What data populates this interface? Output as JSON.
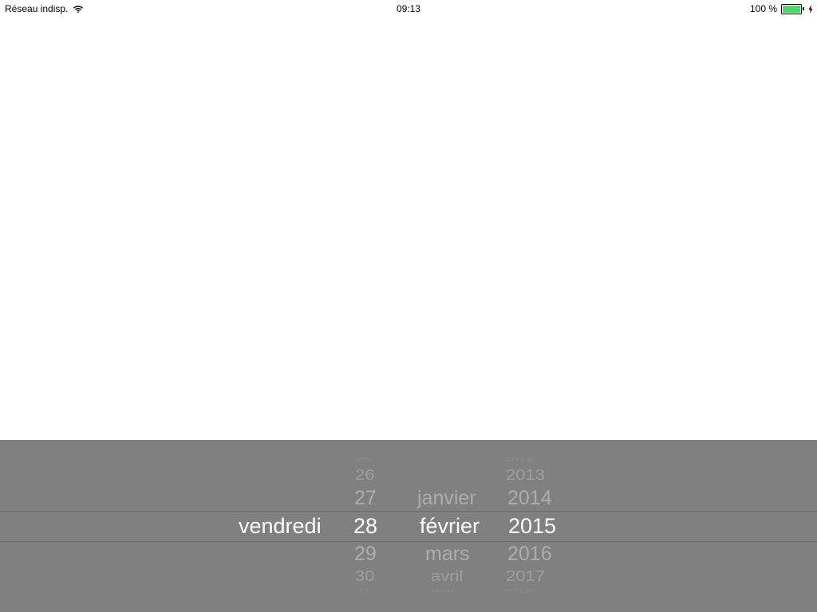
{
  "status_bar": {
    "carrier": "Réseau indisp.",
    "time": "09:13",
    "battery_percent": "100 %",
    "battery_level": 1.0,
    "battery_color": "#4cd964",
    "icons": [
      "wifi-icon",
      "battery-icon",
      "charge-icon"
    ]
  },
  "picker": {
    "background": "#808080",
    "line_color": "#6b6b6b",
    "selected": {
      "weekday": "vendredi",
      "day": "28",
      "month": "février",
      "year": "2015"
    },
    "day": {
      "above": [
        "25",
        "26",
        "27"
      ],
      "below": [
        "29",
        "30",
        "31"
      ]
    },
    "month": {
      "above": [
        "janvier"
      ],
      "below": [
        "mars",
        "avril",
        "mai"
      ]
    },
    "year": {
      "above": [
        "2012",
        "2013",
        "2014"
      ],
      "below": [
        "2016",
        "2017",
        "2018"
      ]
    }
  }
}
